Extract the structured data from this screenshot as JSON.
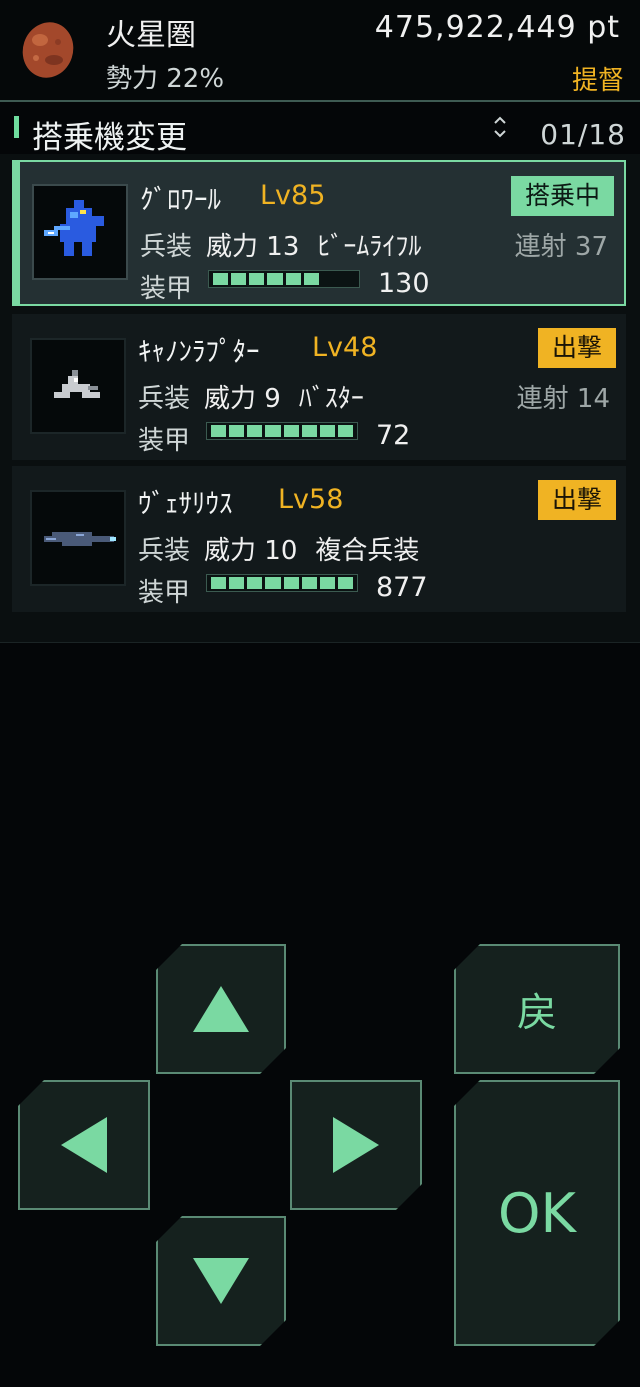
{
  "header": {
    "planet_name": "火星圏",
    "influence": "勢力 22%",
    "points": "475,922,449 pt",
    "rank": "提督"
  },
  "section": {
    "title": "搭乗機変更",
    "page": "01/18"
  },
  "units": [
    {
      "name": "ｸﾞﾛﾜｰﾙ",
      "level": "Lv85",
      "status": "搭乗中",
      "weapon_label": "兵装",
      "power": "威力 13",
      "weapon": "ﾋﾞｰﾑﾗｲﾌﾙ",
      "rapid": "連射 37",
      "armor_label": "装甲",
      "armor": "130",
      "armor_level": 0.8
    },
    {
      "name": "ｷｬﾉﾝﾗﾌﾟﾀｰ",
      "level": "Lv48",
      "status": "出撃",
      "weapon_label": "兵装",
      "power": "威力 9",
      "weapon": "ﾊﾞｽﾀｰ",
      "rapid": "連射 14",
      "armor_label": "装甲",
      "armor": "72",
      "armor_level": 1.0
    },
    {
      "name": "ｳﾞｪｻﾘｳｽ",
      "level": "Lv58",
      "status": "出撃",
      "weapon_label": "兵装",
      "power": "威力 10",
      "weapon": "複合兵装",
      "rapid": "",
      "armor_label": "装甲",
      "armor": "877",
      "armor_level": 1.0
    }
  ],
  "controls": {
    "back": "戻",
    "ok": "OK"
  },
  "colors": {
    "accent": "#7ad9a2",
    "level": "#f0b323",
    "background": "#040608"
  }
}
